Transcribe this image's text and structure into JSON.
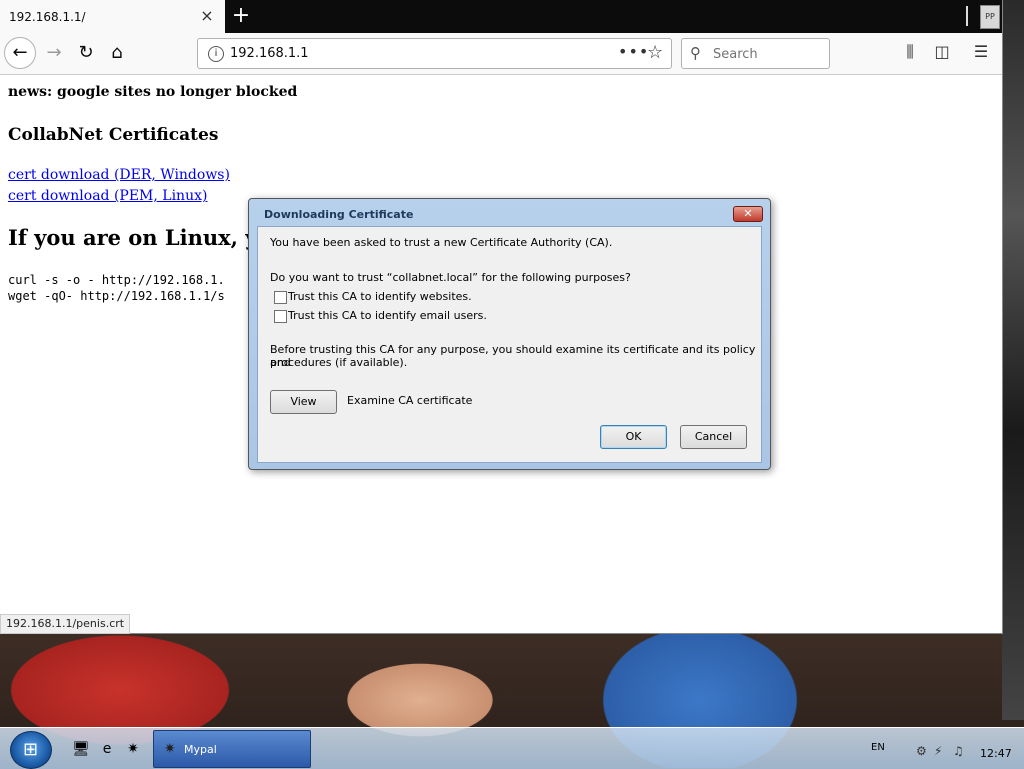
{
  "browser": {
    "tab_title": "192.168.1.1/",
    "url": "192.168.1.1",
    "search_placeholder": "Search",
    "status_url": "192.168.1.1/penis.crt"
  },
  "page": {
    "news": "news: google sites no longer blocked",
    "heading": "CollabNet Certificates",
    "link_der": "cert download (DER, Windows)",
    "link_pem": "cert download (PEM, Linux)",
    "linux_heading": "If you are on Linux, you",
    "curl_line": "curl -s -o - http://192.168.1.",
    "wget_line": "wget -qO- http://192.168.1.1/s"
  },
  "dialog": {
    "title": "Downloading Certificate",
    "line1": "You have been asked to trust a new Certificate Authority (CA).",
    "line2": "Do you want to trust “collabnet.local” for the following purposes?",
    "cb_websites": "Trust this CA to identify websites.",
    "cb_email": "Trust this CA to identify email users.",
    "line3a": "Before trusting this CA for any purpose, you should examine its certificate and its policy and",
    "line3b": "procedures (if available).",
    "view_label": "View",
    "examine_label": "Examine CA certificate",
    "ok_label": "OK",
    "cancel_label": "Cancel"
  },
  "taskbar": {
    "task_label": "Mypal",
    "lang": "EN",
    "clock": "12:47"
  },
  "icons": {
    "back": "back-arrow-icon",
    "forward": "forward-arrow-icon",
    "reload": "reload-icon",
    "home": "home-icon",
    "info": "info-icon",
    "star": "star-icon",
    "search": "search-icon",
    "library": "library-icon",
    "sidebar": "sidebar-icon",
    "menu": "hamburger-menu-icon"
  }
}
